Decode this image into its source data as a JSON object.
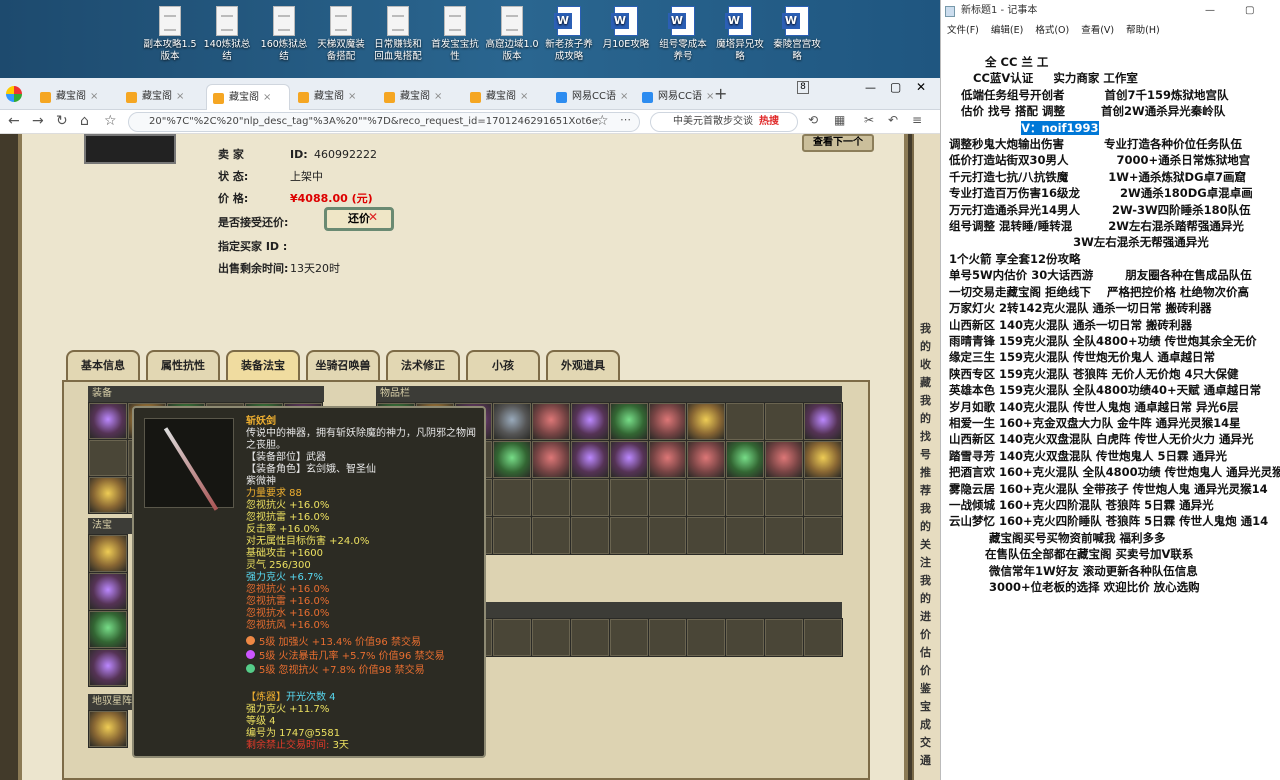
{
  "desktop_icons": [
    {
      "label": "副本攻略1.5版本",
      "type": "doc"
    },
    {
      "label": "140炼狱总结",
      "type": "doc"
    },
    {
      "label": "160炼狱总结",
      "type": "doc"
    },
    {
      "label": "天梯双魔装备搭配",
      "type": "doc"
    },
    {
      "label": "日常赚钱和回血鬼搭配",
      "type": "doc"
    },
    {
      "label": "首发宝宝抗性",
      "type": "doc"
    },
    {
      "label": "高窟边域1.0版本",
      "type": "doc"
    },
    {
      "label": "新老孩子养成攻略",
      "type": "word"
    },
    {
      "label": "月10E攻略",
      "type": "word"
    },
    {
      "label": "组号零成本养号",
      "type": "word"
    },
    {
      "label": "魔塔异兄攻略",
      "type": "word"
    },
    {
      "label": "秦陵宫宫攻略",
      "type": "word"
    }
  ],
  "browser": {
    "tabs": [
      "藏宝阁",
      "藏宝阁",
      "藏宝阁",
      "藏宝阁",
      "藏宝阁",
      "藏宝阁",
      "网易CC语",
      "网易CC语"
    ],
    "tab_count": "8",
    "url": "20\"%7C\"%2C%20\"nlp_desc_tag\"%3A%20\"\"%7D&reco_request_id=1701246291651Xot6e",
    "search": "中美元首散步交谈",
    "hot": "热搜"
  },
  "listing": {
    "seller_label": "卖  家",
    "seller_id_label": "ID:",
    "seller_id": "460992222",
    "status_label": "状     态:",
    "status": "上架中",
    "price_label": "价     格:",
    "price": "¥4088.00 (元)",
    "bargain_label": "是否接受还价:",
    "bargain_btn": "还价",
    "buyer_label": "指定买家 ID :",
    "buyer": "",
    "time_label": "出售剩余时间:",
    "time": "13天20时",
    "next_btn": "查看下一个"
  },
  "game_tabs": [
    "基本信息",
    "属性抗性",
    "装备法宝",
    "坐骑召唤兽",
    "法术修正",
    "小孩",
    "外观道具"
  ],
  "panels": {
    "equip": "装备",
    "fabao": "法宝",
    "mount": "地驭星阵",
    "items": "物品栏"
  },
  "tooltip": {
    "name": "斩妖剑",
    "desc": "传说中的神器，拥有斩妖除魔的神力，凡阴邪之物闻之丧胆。",
    "slot": "【装备部位】武器",
    "role": "【装备角色】玄剑娥、智圣仙",
    "sub": "紫微神",
    "stats": [
      {
        "t": "力量要求 88",
        "c": "c-o"
      },
      {
        "t": "忽视抗火 +16.0%",
        "c": "c-y"
      },
      {
        "t": "忽视抗雷 +16.0%",
        "c": "c-y"
      },
      {
        "t": "反击率 +16.0%",
        "c": "c-y"
      },
      {
        "t": "对无属性目标伤害 +24.0%",
        "c": "c-y"
      },
      {
        "t": "基础攻击 +1600",
        "c": "c-y"
      },
      {
        "t": "灵气 256/300",
        "c": "c-y"
      },
      {
        "t": "强力克火 +6.7%",
        "c": "c-c"
      },
      {
        "t": "忽视抗火 +16.0%",
        "c": "c-org"
      },
      {
        "t": "忽视抗雷 +16.0%",
        "c": "c-org"
      },
      {
        "t": "忽视抗水 +16.0%",
        "c": "c-org"
      },
      {
        "t": "忽视抗风 +16.0%",
        "c": "c-org"
      }
    ],
    "gems": [
      "5级 加强火 +13.4% 价值96 禁交易",
      "5级 火法暴击几率 +5.7% 价值96 禁交易",
      "5级 忽视抗火 +7.8% 价值98 禁交易"
    ],
    "refine_label": "【炼器】",
    "refine": "开光次数 4",
    "refine_stat": "强力克火 +11.7%",
    "level": "等级 4",
    "serial": "编号为 1747@5581",
    "trade_label": "剩余禁止交易时间:",
    "trade_time": "3天"
  },
  "notepad": {
    "title": "新标题1 - 记事本",
    "menu": [
      "文件(F)",
      "编辑(E)",
      "格式(O)",
      "查看(V)",
      "帮助(H)"
    ],
    "lines": [
      "         全 CC 兰 工",
      "      CC蓝V认证     实力商家 工作室",
      "   低端任务组号开创者          首创7千159炼狱地宫队",
      "   估价 找号 搭配 调整         首创2W通杀异光秦岭队",
      "                  V：noif1993",
      "",
      "调整秒鬼大炮输出伤害          专业打造各种价位任务队伍",
      "低价打造站街双30男人            7000+通杀日常炼狱地宫",
      "千元打造七抗/八抗铁魔          1W+通杀炼狱DG卓7画窟",
      "专业打造百万伤害16级龙          2W通杀180DG卓混卓画",
      "万元打造通杀异光14男人        2W-3W四阶睡杀180队伍",
      "组号调整 混转睡/睡转混         2W左右混杀踏帮强通异光",
      "                               3W左右混杀无帮强通异光",
      "1个火箭 享全套12份攻略",
      "单号5W内估价 30大话西游        朋友圈各种在售成品队伍",
      "一切交易走藏宝阁 拒绝线下    严格把控价格 杜绝物次价高",
      "",
      "",
      "万家灯火 2转142克火混队 通杀一切日常 搬砖利器",
      "山西新区 140克火混队 通杀一切日常 搬砖利器",
      "雨晴青锋 159克火混队 全队4800+功绩 传世炮其余全无价",
      "缘定三生 159克火混队 传世炮无价鬼人 通卓越日常",
      "陕西专区 159克火混队 苍狼阵 无价人无价炮 4只大保健",
      "英雄本色 159克火混队 全队4800功绩40+天赋 通卓越日常",
      "岁月如歌 140克火混队 传世人鬼炮 通卓越日常 异光6层",
      "相爱一生 160+克金双盘大力队 金牛阵 通异光灵猴14星",
      "山西新区 140克火双盘混队 白虎阵 传世人无价火力 通异光",
      "踏雪寻芳 140克火双盘混队 传世炮鬼人 5日霖 通异光",
      "把酒言欢 160+克火混队 全队4800功绩 传世炮鬼人 通异光灵猴",
      "雾隐云居 160+克火混队 全带孩子 传世炮人鬼 通异光灵猴14",
      "一战倾城 160+克火四阶混队 苍狼阵 5日霖 通异光",
      "云山梦忆 160+克火四阶睡队 苍狼阵 5日霖 传世人鬼炮 通14",
      "",
      "",
      "          藏宝阁买号买物资前喊我 福利多多",
      "         在售队伍全部都在藏宝阁 买卖号加V联系",
      "          微信常年1W好友 滚动更新各种队伍信息",
      "          3000+位老板的选择 欢迎比价 放心选购"
    ]
  },
  "sidebar_chars": [
    "我",
    "的",
    "收",
    "藏",
    "我",
    "的",
    "找",
    "号",
    "推",
    "荐",
    "我",
    "的",
    "关",
    "注",
    "我",
    "的",
    "进",
    "价",
    "估",
    "价",
    "鉴",
    "宝",
    "成",
    "交",
    "通"
  ]
}
